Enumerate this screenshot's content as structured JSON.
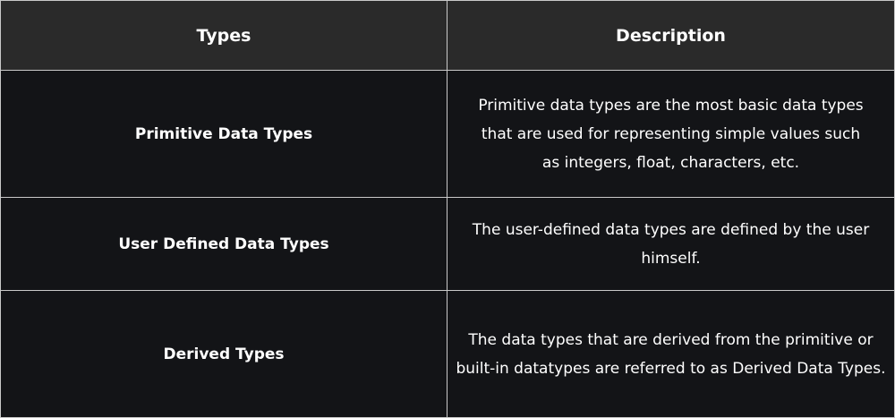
{
  "table": {
    "headers": [
      "Types",
      "Description"
    ],
    "rows": [
      {
        "type": "Primitive Data Types",
        "description": "Primitive data types are the most basic data types that are used for representing simple values such as integers, float, characters, etc."
      },
      {
        "type": "User Defined Data Types",
        "description": "The user-defined data types are defined by the user himself."
      },
      {
        "type": "Derived Types",
        "description": "The data types that are derived from the primitive or built-in datatypes are referred to as Derived Data Types."
      }
    ]
  },
  "colors": {
    "background": "#131417",
    "header_background": "#2a2a2a",
    "border": "#c9c9c9",
    "text": "#ffffff"
  }
}
